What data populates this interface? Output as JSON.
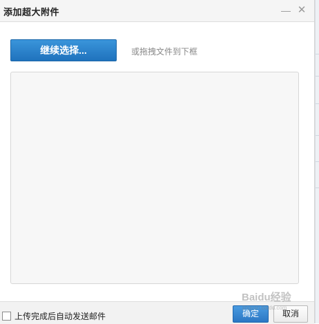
{
  "dialog": {
    "title": "添加超大附件",
    "minimize_glyph": "—",
    "close_glyph": "✕"
  },
  "upload": {
    "select_button_label": "继续选择...",
    "drag_hint": "或拖拽文件到下框"
  },
  "footer": {
    "auto_send_label": "上传完成后自动发送邮件",
    "auto_send_checked": false,
    "ok_label": "确定",
    "cancel_label": "取消"
  },
  "watermark": {
    "text": "Baidu经验",
    "url": "jingyan.baidu.com"
  },
  "colors": {
    "primary": "#2b7fd0",
    "title_bg": "#f5f5f5",
    "drop_area_bg": "#f7f7f7"
  }
}
